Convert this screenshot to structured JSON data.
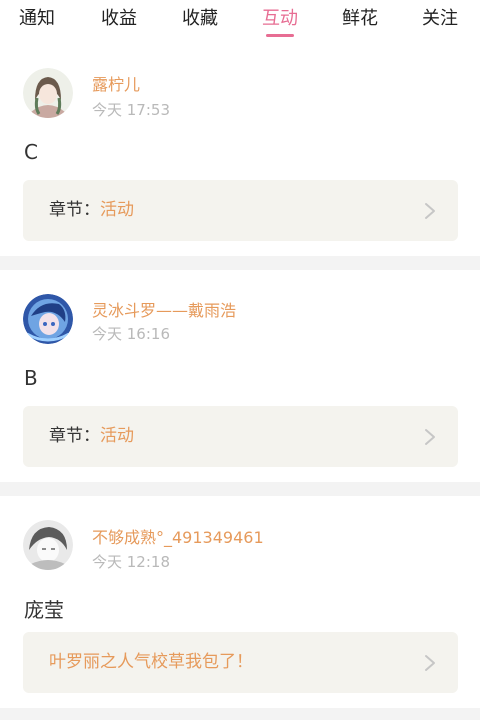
{
  "tabs": [
    {
      "label": "通知"
    },
    {
      "label": "收益"
    },
    {
      "label": "收藏"
    },
    {
      "label": "互动"
    },
    {
      "label": "鲜花"
    },
    {
      "label": "关注"
    }
  ],
  "active_tab": "互动",
  "accent_colors": {
    "tab_active": "#e76d93",
    "username": "#e69a5b",
    "link": "#e69a5b"
  },
  "icons": {
    "chevron": "chevron-right-icon"
  },
  "items": [
    {
      "username": "露柠儿",
      "time": "今天 17:53",
      "content": "C",
      "chapter_label": "章节：",
      "chapter_value": "活动"
    },
    {
      "username": "灵冰斗罗——戴雨浩",
      "time": "今天 16:16",
      "content": "B",
      "chapter_label": "章节：",
      "chapter_value": "活动"
    },
    {
      "username": "不够成熟°_491349461",
      "time": "今天 12:18",
      "content": "庞莹",
      "book_title": "叶罗丽之人气校草我包了！"
    }
  ]
}
